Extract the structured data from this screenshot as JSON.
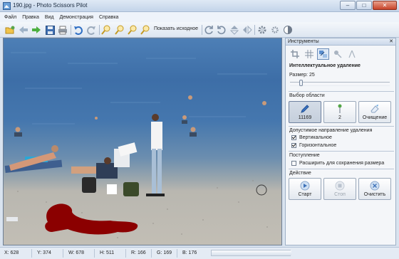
{
  "window": {
    "title": "190.jpg - Photo Scissors Pilot",
    "minimize": "–",
    "maximize": "□",
    "close": "✕"
  },
  "menu": [
    "Файл",
    "Правка",
    "Вид",
    "Демонстрация",
    "Справка"
  ],
  "toolbar": {
    "show_original": "Показать исходное",
    "icons": [
      "open-icon",
      "back-icon",
      "forward-icon",
      "save-icon",
      "print-icon",
      "undo-icon",
      "redo-icon",
      "zoom-in-icon",
      "zoom-out-icon",
      "zoom-fit-icon",
      "zoom-actual-icon",
      "rotate-cw-icon",
      "rotate-ccw-icon",
      "flip-vertical-icon",
      "flip-horizontal-icon",
      "settings-icon",
      "options-icon",
      "contrast-icon"
    ]
  },
  "panel": {
    "title": "Инструменты",
    "close": "✕",
    "tool_icons": [
      "crop-icon",
      "grid-icon",
      "smart-remove-icon",
      "brush-icon",
      "compass-icon"
    ],
    "section_title": "Интеллектуальное удаление",
    "size_label": "Размер: 25",
    "size_value": 25,
    "area_label": "Выбор области",
    "area_buttons": [
      {
        "label": "11169",
        "icon": "pencil-icon",
        "pressed": true
      },
      {
        "label": "2",
        "icon": "marker-icon",
        "pressed": false
      },
      {
        "label": "Очищение",
        "icon": "eraser-icon",
        "pressed": false
      }
    ],
    "direction_label": "Допустимое направление удаления",
    "vertical_label": "Вертикальное",
    "vertical_checked": true,
    "horizontal_label": "Горизонтальное",
    "horizontal_checked": true,
    "progress_label": "Поступление",
    "expand_label": "Расширить для сохранения размера",
    "expand_checked": false,
    "action_label": "Действие",
    "start_label": "Старт",
    "stop_label": "Стоп",
    "clear_label": "Очистить"
  },
  "status": {
    "x": "X: 628",
    "y": "Y: 374",
    "w": "W: 678",
    "h": "H: 511",
    "r": "R: 166",
    "g": "G: 169",
    "b": "B: 176"
  },
  "colors": {
    "mask": "#8b0000",
    "accent": "#3c6bb0"
  }
}
